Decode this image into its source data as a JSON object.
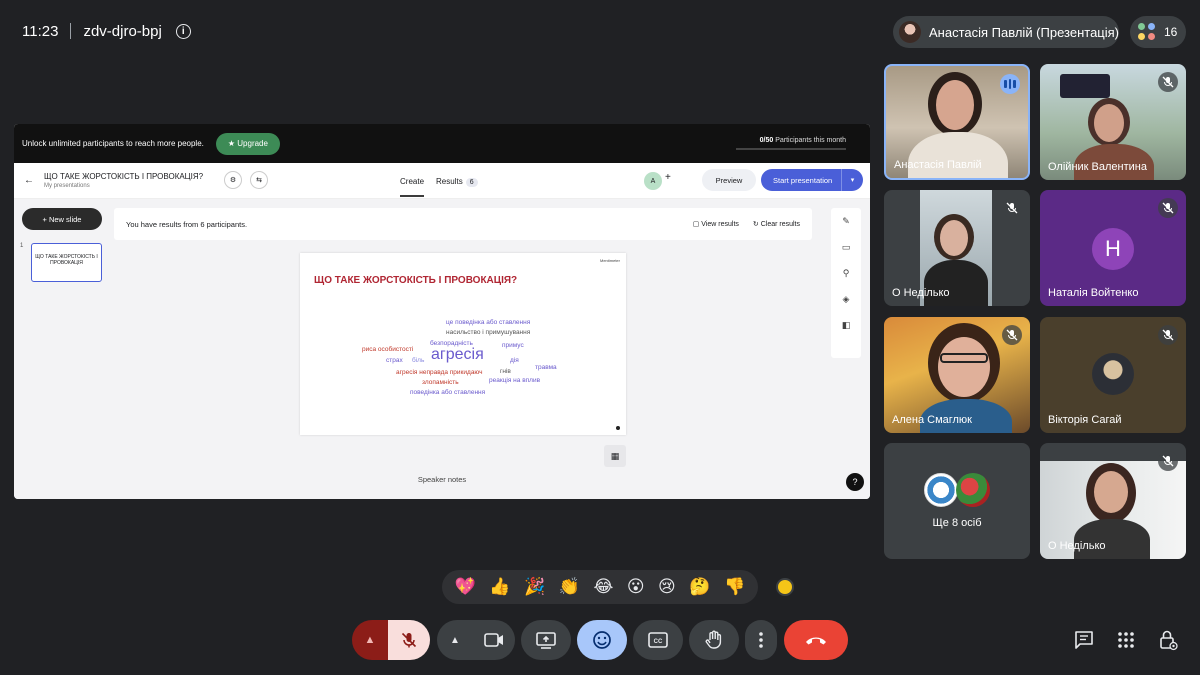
{
  "topbar": {
    "time": "11:23",
    "meeting_code": "zdv-djro-bpj",
    "presenter_chip": "Анастасія Павлій (Презентація)",
    "participant_count": "16"
  },
  "presentation": {
    "banner": {
      "text": "Unlock unlimited participants to reach more people.",
      "upgrade": "★ Upgrade",
      "participants_count": "0/50",
      "participants_label": "Participants this month"
    },
    "header": {
      "title": "ЩО ТАКЕ ЖОРСТОКІСТЬ І ПРОВОКАЦІЯ?",
      "subtitle": "My presentations",
      "tab_create": "Create",
      "tab_results": "Results",
      "results_count": "6",
      "avatar_letter": "A",
      "preview": "Preview",
      "start": "Start presentation"
    },
    "new_slide": "+ New slide",
    "slide_number": "1",
    "thumb_title": "ЩО ТАКЕ ЖОРСТОКІСТЬ І ПРОВОКАЦІЯ",
    "results_info": "You have results from 6 participants.",
    "view_results": "View results",
    "clear_results": "Clear results",
    "slide": {
      "logo": "Mentimeter",
      "title": "ЩО ТАКЕ ЖОРСТОКІСТЬ І ПРОВОКАЦІЯ?",
      "words": [
        "це поведінка або ставлення",
        "насильство і примушування",
        "безпорадність",
        "примус",
        "риса особистості",
        "страх",
        "біль",
        "агресія",
        "дія",
        "травма",
        "агресія неправда прикидаюч",
        "гнів",
        "злопамність",
        "реакція на вплив",
        "поведінка або ставлення"
      ]
    },
    "speaker_notes": "Speaker notes",
    "help": "?"
  },
  "participants": [
    {
      "name": "Анастасія Павлій"
    },
    {
      "name": "Олійник Валентина"
    },
    {
      "name": "О Неділько"
    },
    {
      "name": "Наталія Войтенко",
      "initial": "Н"
    },
    {
      "name": "Алена Смаглюк"
    },
    {
      "name": "Вікторія Сагай"
    },
    {
      "name": "Ще 8 осіб"
    },
    {
      "name": "О Неділько"
    }
  ],
  "reactions": [
    "💖",
    "👍",
    "🎉",
    "👏",
    "😂",
    "😮",
    "😢",
    "🤔",
    "👎"
  ],
  "colors": {
    "background": "#202124",
    "tile": "#3c4043",
    "end_call": "#ea4335",
    "mic_off": "#f9dedc",
    "active_blue": "#8ab4f8",
    "menti_blue": "#4a5fd8",
    "upgrade_green": "#3d8b56",
    "slide_title_red": "#b02633"
  },
  "icons": [
    "info-icon",
    "mic-off-icon",
    "camera-icon",
    "present-icon",
    "emoji-icon",
    "captions-icon",
    "raise-hand-icon",
    "more-icon",
    "end-call-icon",
    "chat-icon",
    "activities-icon",
    "host-controls-icon"
  ]
}
